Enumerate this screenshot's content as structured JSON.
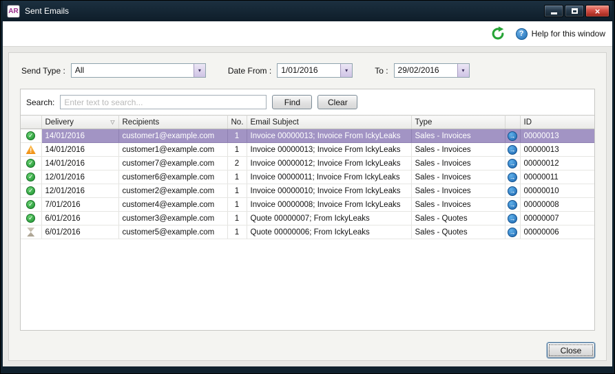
{
  "window": {
    "title": "Sent Emails",
    "logo": "AR"
  },
  "toolbar": {
    "help_label": "Help for this window"
  },
  "filters": {
    "send_type_label": "Send Type :",
    "send_type_value": "All",
    "date_from_label": "Date From :",
    "date_from_value": "1/01/2016",
    "to_label": "To :",
    "to_value": "29/02/2016"
  },
  "search": {
    "label": "Search:",
    "placeholder": "Enter text to search...",
    "find_label": "Find",
    "clear_label": "Clear"
  },
  "table": {
    "headers": {
      "delivery": "Delivery",
      "recipients": "Recipients",
      "no": "No.",
      "subject": "Email Subject",
      "type": "Type",
      "id": "ID"
    },
    "rows": [
      {
        "status": "delivered",
        "delivery": "14/01/2016",
        "recipients": "customer1@example.com",
        "no": "1",
        "subject": "Invoice 00000013; Invoice From IckyLeaks",
        "type": "Sales - Invoices",
        "id": "00000013",
        "selected": true
      },
      {
        "status": "warning",
        "delivery": "14/01/2016",
        "recipients": "customer1@example.com",
        "no": "1",
        "subject": "Invoice 00000013; Invoice From IckyLeaks",
        "type": "Sales - Invoices",
        "id": "00000013",
        "selected": false
      },
      {
        "status": "delivered",
        "delivery": "14/01/2016",
        "recipients": "customer7@example.com",
        "no": "2",
        "subject": "Invoice 00000012; Invoice From IckyLeaks",
        "type": "Sales - Invoices",
        "id": "00000012",
        "selected": false
      },
      {
        "status": "delivered",
        "delivery": "12/01/2016",
        "recipients": "customer6@example.com",
        "no": "1",
        "subject": "Invoice 00000011; Invoice From IckyLeaks",
        "type": "Sales - Invoices",
        "id": "00000011",
        "selected": false
      },
      {
        "status": "delivered",
        "delivery": "12/01/2016",
        "recipients": "customer2@example.com",
        "no": "1",
        "subject": "Invoice 00000010; Invoice From IckyLeaks",
        "type": "Sales - Invoices",
        "id": "00000010",
        "selected": false
      },
      {
        "status": "delivered",
        "delivery": "7/01/2016",
        "recipients": "customer4@example.com",
        "no": "1",
        "subject": "Invoice 00000008; Invoice From IckyLeaks",
        "type": "Sales - Invoices",
        "id": "00000008",
        "selected": false
      },
      {
        "status": "delivered",
        "delivery": "6/01/2016",
        "recipients": "customer3@example.com",
        "no": "1",
        "subject": "Quote 00000007; From IckyLeaks",
        "type": "Sales - Quotes",
        "id": "00000007",
        "selected": false
      },
      {
        "status": "queued",
        "delivery": "6/01/2016",
        "recipients": "customer5@example.com",
        "no": "1",
        "subject": "Quote 00000006; From IckyLeaks",
        "type": "Sales - Quotes",
        "id": "00000006",
        "selected": false
      }
    ]
  },
  "footer": {
    "close_label": "Close"
  },
  "icons": {
    "help": "?",
    "dropdown_arrow": "▾",
    "filter": "▽",
    "check": "✓",
    "warning": "!",
    "open_arrow": "→",
    "close_x": "×"
  },
  "colors": {
    "selected_row": "#a294c4",
    "accent_purple": "#9b2d8e",
    "success_green": "#1d9130",
    "warning_orange": "#ef8d10",
    "link_blue": "#1a64ae",
    "titlebar": "#0e1d29"
  }
}
